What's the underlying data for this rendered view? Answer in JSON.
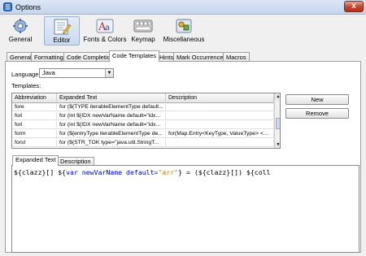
{
  "window": {
    "title": "Options",
    "close_symbol": "x"
  },
  "categories": [
    {
      "label": "General",
      "icon": "general-icon"
    },
    {
      "label": "Editor",
      "icon": "editor-icon",
      "selected": true
    },
    {
      "label": "Fonts & Colors",
      "icon": "fonts-colors-icon"
    },
    {
      "label": "Keymap",
      "icon": "keyboard-icon"
    },
    {
      "label": "Miscellaneous",
      "icon": "miscellaneous-icon"
    }
  ],
  "tabs": [
    "General",
    "Formatting",
    "Code Completion",
    "Code Templates",
    "Hints",
    "Mark Occurrences",
    "Macros"
  ],
  "active_tab": "Code Templates",
  "language": {
    "label": "Language:",
    "value": "Java"
  },
  "templates_label": "Templates:",
  "table": {
    "columns": [
      "Abbreviation",
      "Expanded Text",
      "Description"
    ],
    "rows": [
      [
        "fore",
        "for (${TYPE iterableElementType default...",
        ""
      ],
      [
        "fori",
        "for (int ${IDX newVarName default=\"idx...",
        ""
      ],
      [
        "forl",
        "for (int ${IDX newVarName default=\"idx...",
        ""
      ],
      [
        "form",
        "for (${entryType iterableElementType de...",
        "for(Map.Entry<KeyType, ValueType> <..."
      ],
      [
        "forst",
        "for (${STR_TOK type=\"java.util.StringT...",
        ""
      ]
    ]
  },
  "buttons": {
    "new": "New",
    "remove": "Remove"
  },
  "bottom_tabs": [
    "Expanded Text",
    "Description"
  ],
  "editor": {
    "p1": "${clazz}[] ${",
    "kw1": "var newVarName default=",
    "str1": "\"arr\"",
    "p2": "} = (${clazz}[]) ${coll"
  }
}
